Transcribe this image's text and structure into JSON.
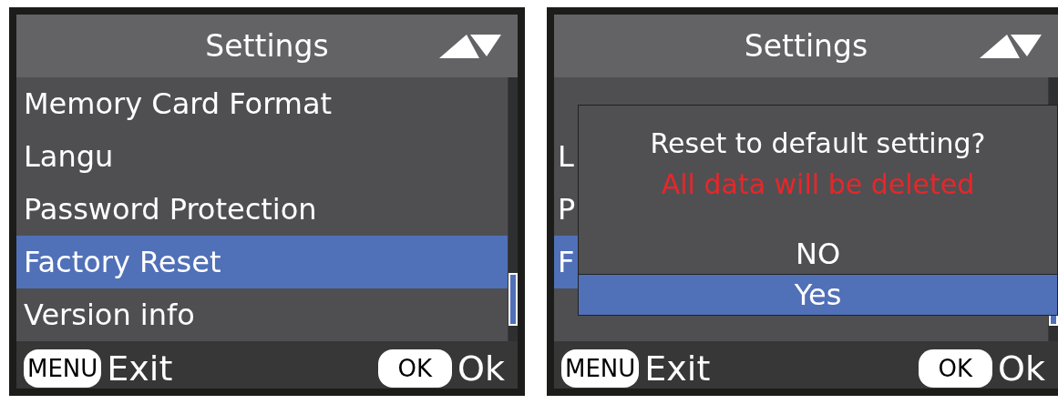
{
  "screens": [
    {
      "header": {
        "title": "Settings"
      },
      "menu": {
        "items": [
          {
            "label": "Memory Card Format",
            "selected": false
          },
          {
            "label": "Langu",
            "selected": false
          },
          {
            "label": "Password Protection",
            "selected": false
          },
          {
            "label": "Factory Reset",
            "selected": true
          },
          {
            "label": "Version info",
            "selected": false
          }
        ]
      },
      "footer": [
        {
          "key": "MENU",
          "label": "Exit"
        },
        {
          "key": "OK",
          "label": "Ok"
        }
      ]
    },
    {
      "header": {
        "title": "Settings"
      },
      "menu": {
        "items": [
          {
            "selected": false
          },
          {
            "label": "L",
            "selected": false
          },
          {
            "label": "P",
            "selected": false
          },
          {
            "label": "F",
            "selected": true
          },
          {
            "selected": false
          }
        ]
      },
      "dialog": {
        "question": "Reset to default setting?",
        "warning": "All data will be deleted",
        "options": [
          {
            "label": "NO",
            "selected": false
          },
          {
            "label": "Yes",
            "selected": true
          }
        ]
      },
      "footer": [
        {
          "key": "MENU",
          "label": "Exit"
        },
        {
          "key": "OK",
          "label": "Ok"
        }
      ]
    }
  ]
}
